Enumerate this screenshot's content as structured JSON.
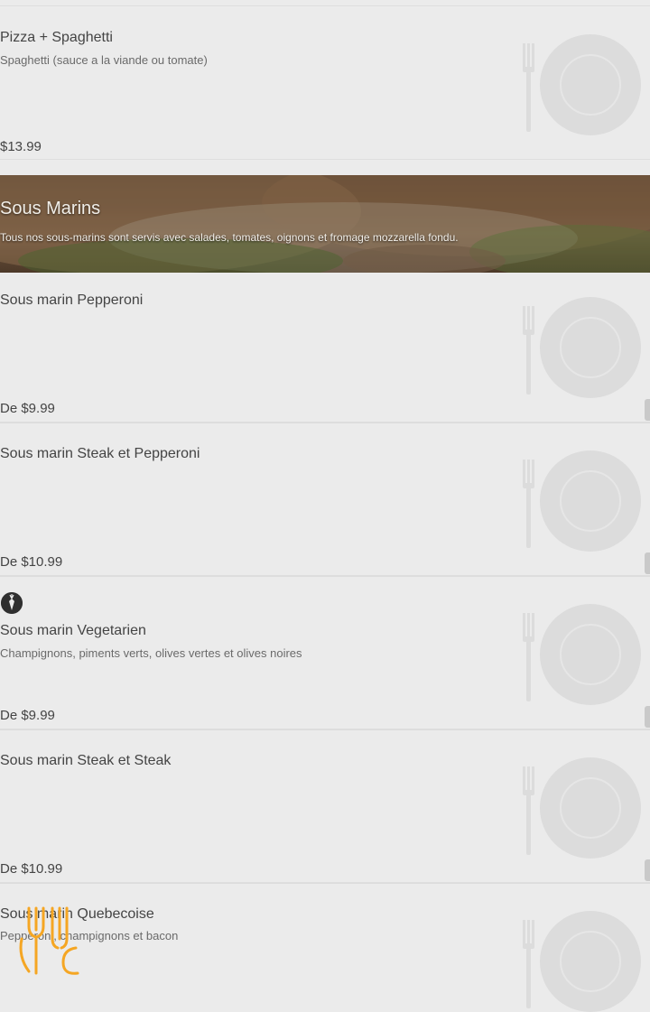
{
  "section": {
    "title": "Sous Marins",
    "description": "Tous nos sous-marins sont servis avec salades, tomates, oignons et fromage mozzarella fondu."
  },
  "items": [
    {
      "name": "Pizza + Spaghetti",
      "description": "Spaghetti (sauce a la viande ou tomate)",
      "price": "$13.99"
    },
    {
      "name": "Sous marin Pepperoni",
      "description": "",
      "price": "De $9.99"
    },
    {
      "name": "Sous marin Steak et Pepperoni",
      "description": "",
      "price": "De $10.99"
    },
    {
      "name": "Sous marin Vegetarien",
      "description": "Champignons, piments verts, olives vertes et olives noires",
      "price": "De $9.99"
    },
    {
      "name": "Sous marin Steak et Steak",
      "description": "",
      "price": "De $10.99"
    },
    {
      "name": "Sous marin Quebecoise",
      "description": "Pepperoni, champignons et bacon",
      "price": ""
    }
  ],
  "icons": {
    "placeholder": "plate-fork-icon",
    "vegetarian": "carrot-icon",
    "logo": "fork-logo-icon"
  },
  "colors": {
    "overlay": "#ebebeb",
    "logo": "#f5a623"
  }
}
